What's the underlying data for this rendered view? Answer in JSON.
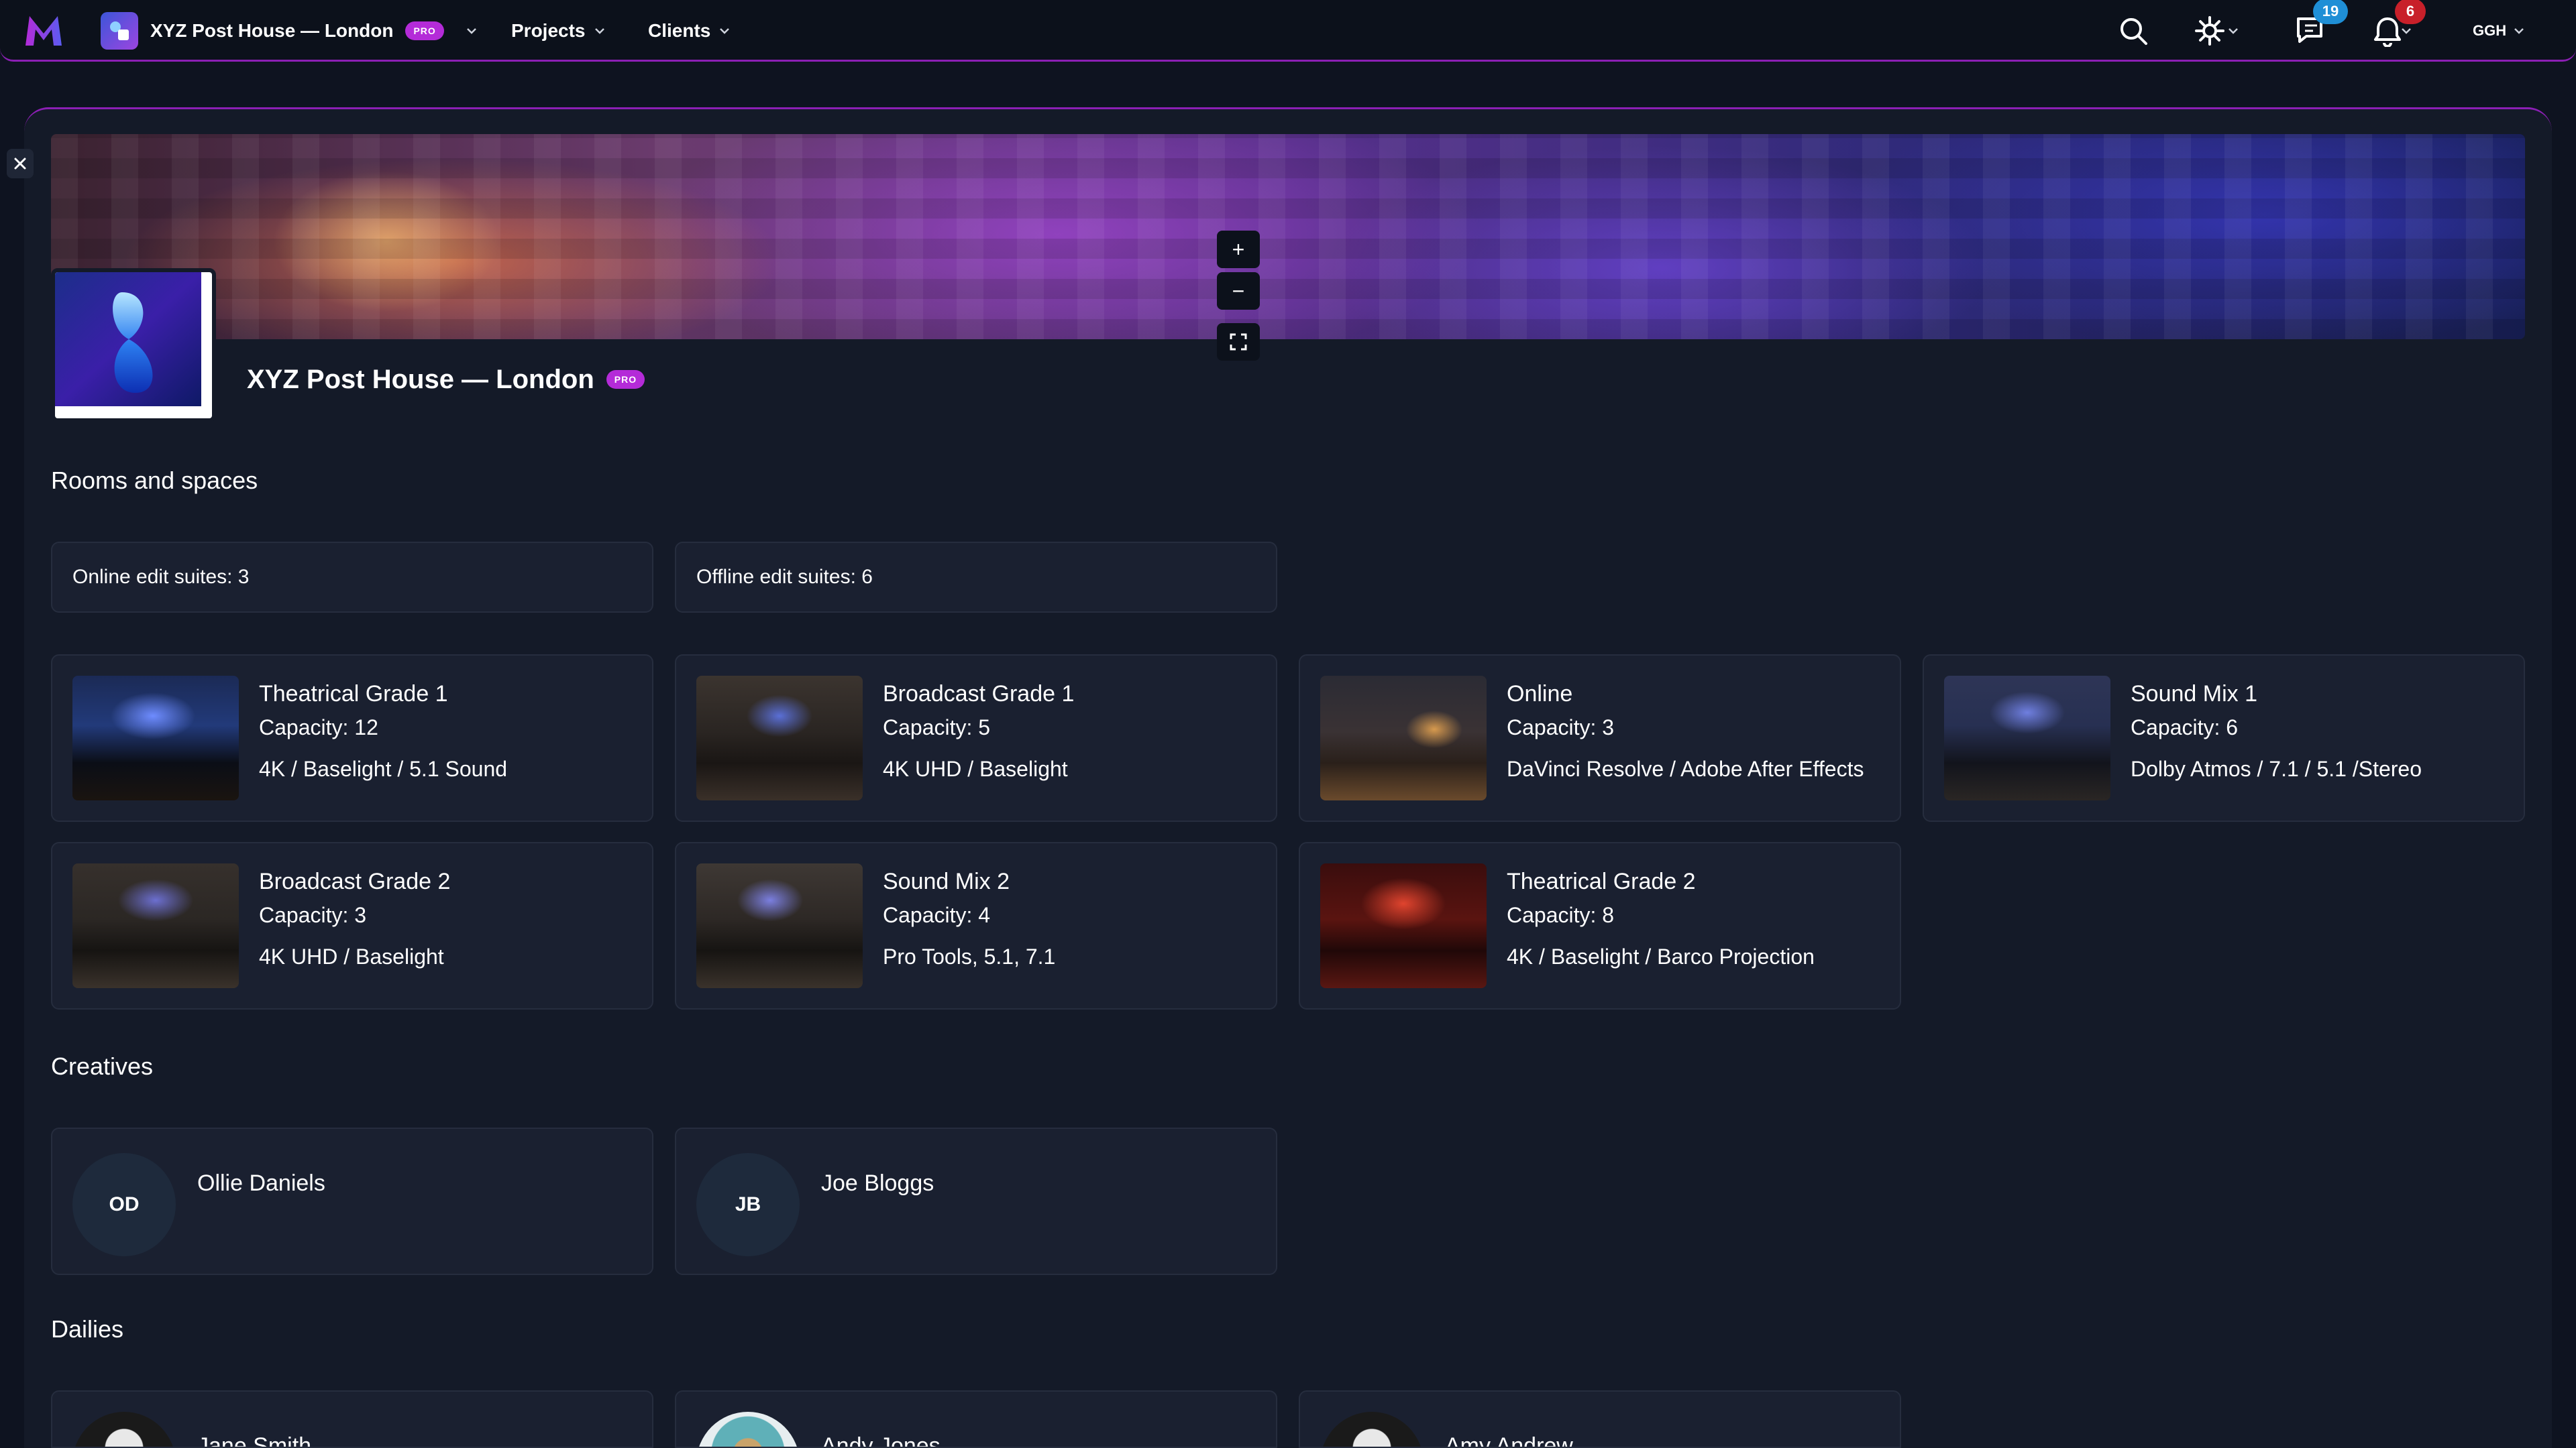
{
  "nav": {
    "org_name": "XYZ Post House — London",
    "pro_badge": "PRO",
    "projects_label": "Projects",
    "clients_label": "Clients",
    "messages_count": "19",
    "notifications_count": "6",
    "user_initials": "GGH",
    "colors": {
      "accent": "#b42bd8",
      "messages_badge": "#1f8fd6",
      "notifications_badge": "#c8202a"
    }
  },
  "profile": {
    "name": "XYZ Post House — London",
    "pro_badge": "PRO"
  },
  "rooms_section": {
    "title": "Rooms and spaces",
    "stats": [
      "Online edit suites: 3",
      "Offline edit suites: 6"
    ],
    "rooms": [
      {
        "name": "Theatrical Grade 1",
        "capacity": "Capacity: 12",
        "spec": "4K / Baselight / 5.1 Sound"
      },
      {
        "name": "Broadcast Grade 1",
        "capacity": "Capacity: 5",
        "spec": "4K UHD / Baselight"
      },
      {
        "name": "Online",
        "capacity": "Capacity: 3",
        "spec": "DaVinci Resolve / Adobe After Effects"
      },
      {
        "name": "Sound Mix 1",
        "capacity": "Capacity: 6",
        "spec": "Dolby Atmos / 7.1 / 5.1 /Stereo"
      },
      {
        "name": "Broadcast Grade 2",
        "capacity": "Capacity: 3",
        "spec": "4K UHD / Baselight"
      },
      {
        "name": "Sound Mix 2",
        "capacity": "Capacity: 4",
        "spec": "Pro Tools, 5.1, 7.1"
      },
      {
        "name": "Theatrical Grade 2",
        "capacity": "Capacity: 8",
        "spec": "4K / Baselight / Barco Projection"
      }
    ]
  },
  "creatives_section": {
    "title": "Creatives",
    "people": [
      {
        "initials": "OD",
        "name": "Ollie Daniels"
      },
      {
        "initials": "JB",
        "name": "Joe Bloggs"
      }
    ]
  },
  "dailies_section": {
    "title": "Dailies",
    "people": [
      {
        "name": "Jane Smith"
      },
      {
        "name": "Andy Jones"
      },
      {
        "name": "Amy Andrew"
      }
    ]
  }
}
